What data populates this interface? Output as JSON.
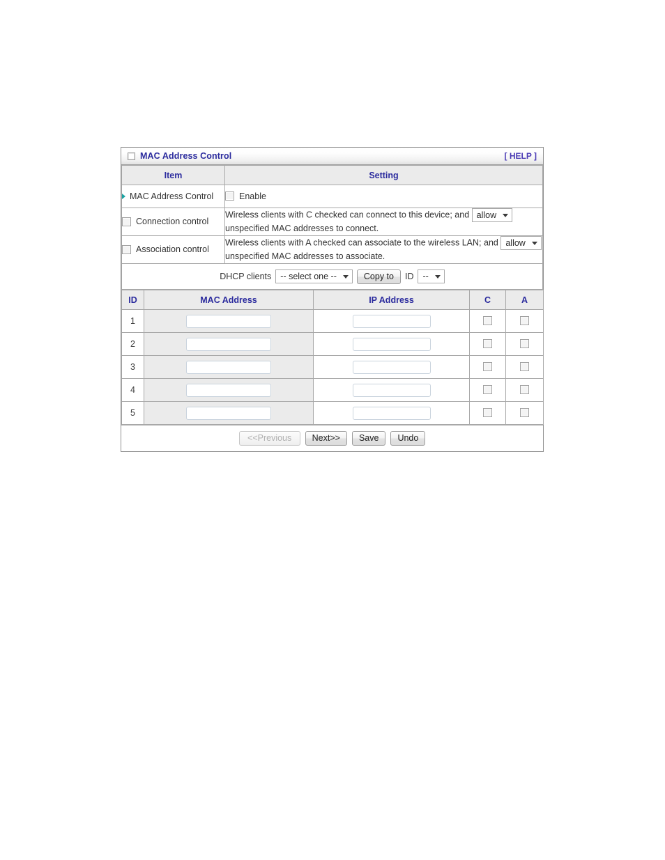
{
  "panel": {
    "title": "MAC Address Control",
    "help_label": "[ HELP ]",
    "title_icon": "window-square-icon",
    "accent_title_color": "#2b2b9e",
    "accent_help_color": "#4b3bb5",
    "bullet_color": "#1aa3a3"
  },
  "columns": {
    "item": "Item",
    "setting": "Setting"
  },
  "rows": {
    "mac_address_control": {
      "label": "MAC Address Control",
      "enable_label": "Enable",
      "enabled": false
    },
    "connection_control": {
      "label": "Connection control",
      "enabled": false,
      "text_before": "Wireless clients with C checked can connect to this device; and",
      "select_value": "allow",
      "text_after": "unspecified MAC addresses to connect."
    },
    "association_control": {
      "label": "Association control",
      "enabled": false,
      "text_before": "Wireless clients with A checked can associate to the wireless LAN; and",
      "select_value": "allow",
      "text_after": "unspecified MAC addresses to associate."
    },
    "dhcp": {
      "label": "DHCP clients",
      "select_value": "-- select one --",
      "copy_button": "Copy to",
      "id_label": "ID",
      "id_value": "--"
    }
  },
  "table": {
    "headers": {
      "id": "ID",
      "mac": "MAC Address",
      "ip": "IP Address",
      "c": "C",
      "a": "A"
    },
    "placeholder_mac": "",
    "placeholder_ip": "",
    "entries": [
      {
        "id": "1",
        "mac": "",
        "ip": "",
        "c": false,
        "a": false
      },
      {
        "id": "2",
        "mac": "",
        "ip": "",
        "c": false,
        "a": false
      },
      {
        "id": "3",
        "mac": "",
        "ip": "",
        "c": false,
        "a": false
      },
      {
        "id": "4",
        "mac": "",
        "ip": "",
        "c": false,
        "a": false
      },
      {
        "id": "5",
        "mac": "",
        "ip": "",
        "c": false,
        "a": false
      }
    ]
  },
  "footer": {
    "previous": "<<Previous",
    "previous_disabled": true,
    "next": "Next>>",
    "save": "Save",
    "undo": "Undo"
  }
}
